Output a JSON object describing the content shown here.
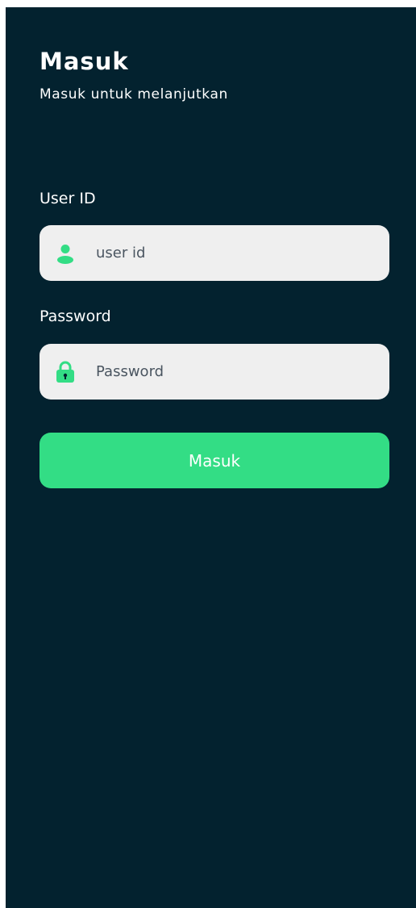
{
  "header": {
    "title": "Masuk",
    "subtitle": "Masuk untuk melanjutkan"
  },
  "form": {
    "user_id": {
      "label": "User ID",
      "placeholder": "user id",
      "value": "",
      "icon": "user-icon"
    },
    "password": {
      "label": "Password",
      "placeholder": "Password",
      "value": "",
      "icon": "lock-icon"
    },
    "submit_label": "Masuk"
  },
  "colors": {
    "background": "#03222f",
    "accent": "#33dd85",
    "field_background": "#efefef",
    "text": "#ffffff"
  }
}
